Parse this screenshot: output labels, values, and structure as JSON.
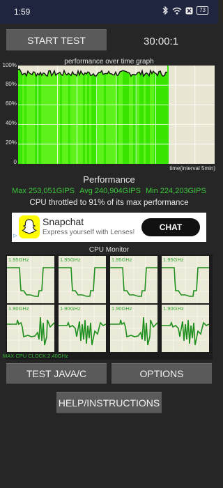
{
  "status_bar": {
    "time": "1:59",
    "battery": "73",
    "icons": [
      "bluetooth-icon",
      "wifi-icon",
      "close-box-icon",
      "battery-icon"
    ]
  },
  "toolbar": {
    "start_label": "START TEST",
    "timer": "30:00:1"
  },
  "graph": {
    "title": "performance over time graph",
    "y_ticks": [
      "100%",
      "80%",
      "60%",
      "40%",
      "20%",
      "0"
    ],
    "x_label": "time(interval 5min)",
    "fill_fraction": 0.76,
    "colors": {
      "fill": "#39e600",
      "fill_alt": "#5cf21a",
      "background": "#e9e7d4",
      "grid": "#ffffff",
      "line": "#111111"
    }
  },
  "performance": {
    "title": "Performance",
    "max": "Max 253,051GIPS",
    "avg": "Avg 240,904GIPS",
    "min": "Min 224,203GIPS",
    "throttle": "CPU throttled to 91% of its max performance"
  },
  "ad": {
    "title": "Snapchat",
    "subtitle": "Express yourself with Lenses!",
    "cta": "CHAT"
  },
  "cpu_monitor": {
    "title": "CPU Monitor",
    "cores": [
      {
        "label": "1.95GHz"
      },
      {
        "label": "1.95GHz"
      },
      {
        "label": "1.95GHz"
      },
      {
        "label": "1.95GHz"
      },
      {
        "label": "1.90GHz"
      },
      {
        "label": "1.90GHz"
      },
      {
        "label": "1.90GHz"
      },
      {
        "label": "1.90GHz"
      }
    ],
    "max_clock": "MAX CPU CLOCK:2.40GHz"
  },
  "buttons": {
    "test_java": "TEST JAVA/C",
    "options": "OPTIONS",
    "help": "HELP/INSTRUCTIONS"
  }
}
